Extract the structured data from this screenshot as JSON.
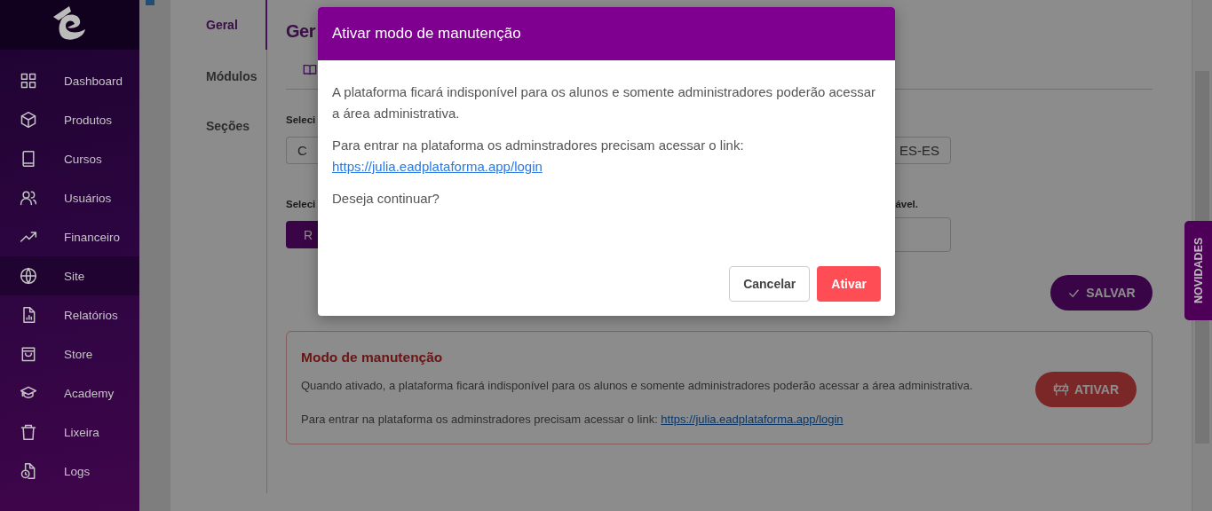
{
  "sidebar": {
    "items": [
      {
        "label": "Dashboard",
        "selected": false
      },
      {
        "label": "Produtos",
        "selected": false
      },
      {
        "label": "Cursos",
        "selected": false
      },
      {
        "label": "Usuários",
        "selected": false
      },
      {
        "label": "Financeiro",
        "selected": false
      },
      {
        "label": "Site",
        "selected": true
      },
      {
        "label": "Relatórios",
        "selected": false
      },
      {
        "label": "Store",
        "selected": false
      },
      {
        "label": "Academy",
        "selected": false
      },
      {
        "label": "Lixeira",
        "selected": false
      },
      {
        "label": "Logs",
        "selected": false
      }
    ]
  },
  "subnav": [
    {
      "label": "Geral",
      "selected": true
    },
    {
      "label": "Módulos",
      "selected": false
    },
    {
      "label": "Seções",
      "selected": false
    }
  ],
  "page": {
    "title": "Ger",
    "language_label": "Seleci",
    "language_buttons": [
      "C",
      "ES-ES"
    ],
    "second_label": "Seleci",
    "second_label_end": "ável.",
    "action_button": "R",
    "save_button": "SALVAR"
  },
  "maintenance_card": {
    "title": "Modo de manutenção",
    "description": "Quando ativado, a plataforma ficará indisponível para os alunos e somente administradores poderão acessar a área administrativa.",
    "link_prompt": "Para entrar na plataforma os adminstradores precisam acessar o link:",
    "link": "https://julia.eadplataforma.app/login",
    "button": "ATIVAR"
  },
  "novidades_tab": "NOVIDADES",
  "modal": {
    "title": "Ativar modo de manutenção",
    "paragraph": "A plataforma ficará indisponível para os alunos e somente administradores poderão acessar a área administrativa.",
    "link_prompt": "Para entrar na plataforma os adminstradores precisam acessar o link:",
    "link": "https://julia.eadplataforma.app/login",
    "question": "Deseja continuar?",
    "buttons": [
      {
        "label": "Cancelar",
        "kind": "secondary"
      },
      {
        "label": "Ativar",
        "kind": "danger"
      }
    ]
  }
}
